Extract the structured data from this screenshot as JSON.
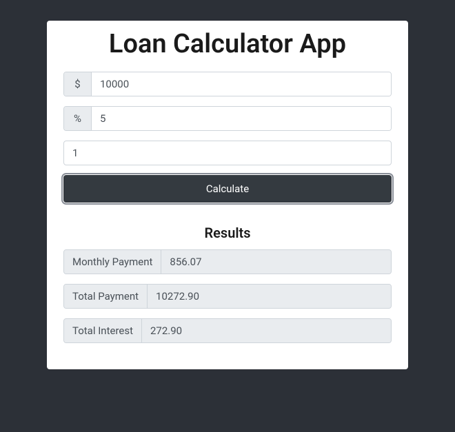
{
  "title": "Loan Calculator App",
  "inputs": {
    "amount": {
      "addon": "$",
      "value": "10000"
    },
    "interest": {
      "addon": "%",
      "value": "5"
    },
    "years": {
      "value": "1"
    }
  },
  "button": {
    "label": "Calculate"
  },
  "results": {
    "heading": "Results",
    "monthly": {
      "label": "Monthly Payment",
      "value": "856.07"
    },
    "total": {
      "label": "Total Payment",
      "value": "10272.90"
    },
    "interest": {
      "label": "Total Interest",
      "value": "272.90"
    }
  }
}
